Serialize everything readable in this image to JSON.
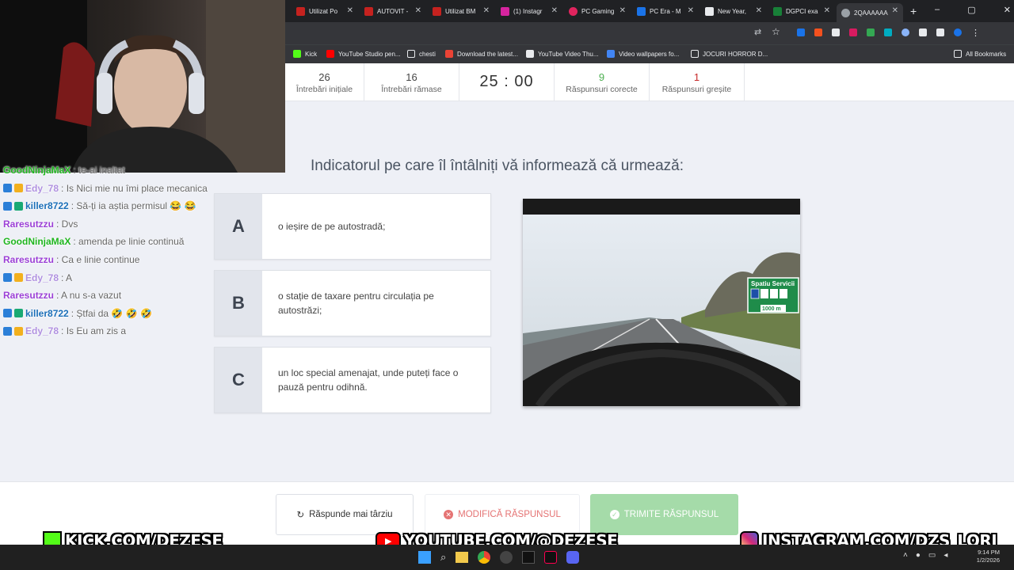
{
  "browser": {
    "tabs": [
      {
        "label": "Utilizat Po",
        "color": "#c5221f"
      },
      {
        "label": "AUTOVIT -",
        "color": "#c5221f"
      },
      {
        "label": "Utilizat BM",
        "color": "#c5221f"
      },
      {
        "label": "(1) Instagr",
        "color": "#d6249f"
      },
      {
        "label": "PC Gaming",
        "color": "#e0245e"
      },
      {
        "label": "PC Era - M",
        "color": "#1a73e8"
      },
      {
        "label": "New Year,",
        "color": "#e8eaed"
      },
      {
        "label": "DGPCI exa",
        "color": "#188038"
      },
      {
        "label": "2QAAAAAA",
        "color": "#9aa0a6"
      }
    ],
    "new_tab": "+",
    "bookmarks": [
      {
        "label": "Kick",
        "color": "#53fc18"
      },
      {
        "label": "YouTube Studio pen...",
        "color": "#ff0000"
      },
      {
        "label": "chesti",
        "color": "#e8eaed"
      },
      {
        "label": "Download the latest...",
        "color": "#ea4335"
      },
      {
        "label": "YouTube Video Thu...",
        "color": "#e8eaed"
      },
      {
        "label": "Video wallpapers fo...",
        "color": "#4285f4"
      },
      {
        "label": "JOCURI HORROR D...",
        "color": "#e8eaed"
      }
    ],
    "all_bookmarks": "All Bookmarks"
  },
  "stats": {
    "initial_count": "26",
    "initial_label": "Întrebări inițiale",
    "remaining_count": "16",
    "remaining_label": "Întrebări rămase",
    "timer": "25 : 00",
    "correct_count": "9",
    "correct_label": "Răspunsuri corecte",
    "wrong_count": "1",
    "wrong_label": "Răspunsuri greșite"
  },
  "question": "Indicatorul pe care îl întâlniți vă informează că urmează:",
  "answers": [
    {
      "letter": "A",
      "text": "o ieșire de pe autostradă;"
    },
    {
      "letter": "B",
      "text": "o stație de taxare pentru circulația pe autostrăzi;"
    },
    {
      "letter": "C",
      "text": "un loc special amenajat, unde puteți face o pauză pentru odihnă."
    }
  ],
  "photo_sign": {
    "title": "Spatiu Servicii",
    "distance": "1000 m"
  },
  "buttons": {
    "later": "Răspunde mai târziu",
    "modify": "MODIFICĂ RĂSPUNSUL",
    "submit": "TRIMITE RĂSPUNSUL"
  },
  "chat": [
    {
      "user": "GoodNinjaMaX",
      "msg": ": te-ai inaltat",
      "color": "#1fb51f",
      "badges": 0
    },
    {
      "user": "Edy_78",
      "msg": ": Is Nici mie nu îmi place mecanica",
      "color": "#b091e0",
      "badges": 2
    },
    {
      "user": "killer8722",
      "msg": ": Să-ți ia aștia permisul 😂 😂",
      "color": "#1b6fb8",
      "badges": 2
    },
    {
      "user": "Raresutzzu",
      "msg": ": Dvs",
      "color": "#9b3fd6",
      "badges": 0
    },
    {
      "user": "GoodNinjaMaX",
      "msg": ": amenda pe linie continuă",
      "color": "#1fb51f",
      "badges": 0
    },
    {
      "user": "Raresutzzu",
      "msg": ": Ca e linie continue",
      "color": "#9b3fd6",
      "badges": 0
    },
    {
      "user": "Edy_78",
      "msg": ": A",
      "color": "#b091e0",
      "badges": 2
    },
    {
      "user": "Raresutzzu",
      "msg": ": A nu s-a vazut",
      "color": "#9b3fd6",
      "badges": 0
    },
    {
      "user": "killer8722",
      "msg": ": Ștfai da 🤣 🤣 🤣",
      "color": "#1b6fb8",
      "badges": 2
    },
    {
      "user": "Edy_78",
      "msg": ": Is Eu am zis a",
      "color": "#b091e0",
      "badges": 2
    }
  ],
  "socials": {
    "kick": "KICK.COM/DEZESE",
    "youtube": "YOUTUBE.COM/@DEZESE",
    "instagram": "INSTAGRAM.COM/DZS_LORI"
  },
  "taskbar": {
    "time": "9:14 PM",
    "date": "1/2/2026"
  },
  "colors": {
    "correct": "#4caf50",
    "wrong": "#c62828",
    "submit_bg": "#a5dba9",
    "modify_text": "#e57373"
  }
}
